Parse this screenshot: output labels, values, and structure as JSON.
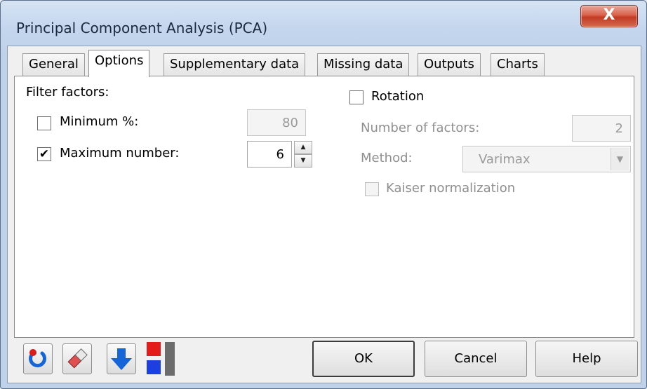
{
  "window": {
    "title": "Principal Component Analysis (PCA)",
    "close_label": "X"
  },
  "tabs": [
    {
      "label": "General"
    },
    {
      "label": "Options",
      "active": true
    },
    {
      "label": "Supplementary data"
    },
    {
      "label": "Missing data"
    },
    {
      "label": "Outputs"
    },
    {
      "label": "Charts"
    }
  ],
  "filter": {
    "heading": "Filter factors:",
    "minimum": {
      "label": "Minimum %:",
      "checked": false,
      "value": "80"
    },
    "maximum": {
      "label": "Maximum number:",
      "checked": true,
      "check_glyph": "✔",
      "value": "6"
    }
  },
  "rotation": {
    "label": "Rotation",
    "checked": false,
    "num_factors": {
      "label": "Number of factors:",
      "value": "2"
    },
    "method": {
      "label": "Method:",
      "value": "Varimax"
    },
    "kaiser": {
      "label": "Kaiser normalization",
      "checked": false
    }
  },
  "toolbar": {
    "icons": [
      "reset-icon",
      "eraser-icon",
      "down-arrow-icon",
      "columns-icon"
    ]
  },
  "buttons": {
    "ok": "OK",
    "cancel": "Cancel",
    "help": "Help"
  },
  "colors": {
    "accent_blue": "#1565d8",
    "close_red": "#c23a23"
  }
}
